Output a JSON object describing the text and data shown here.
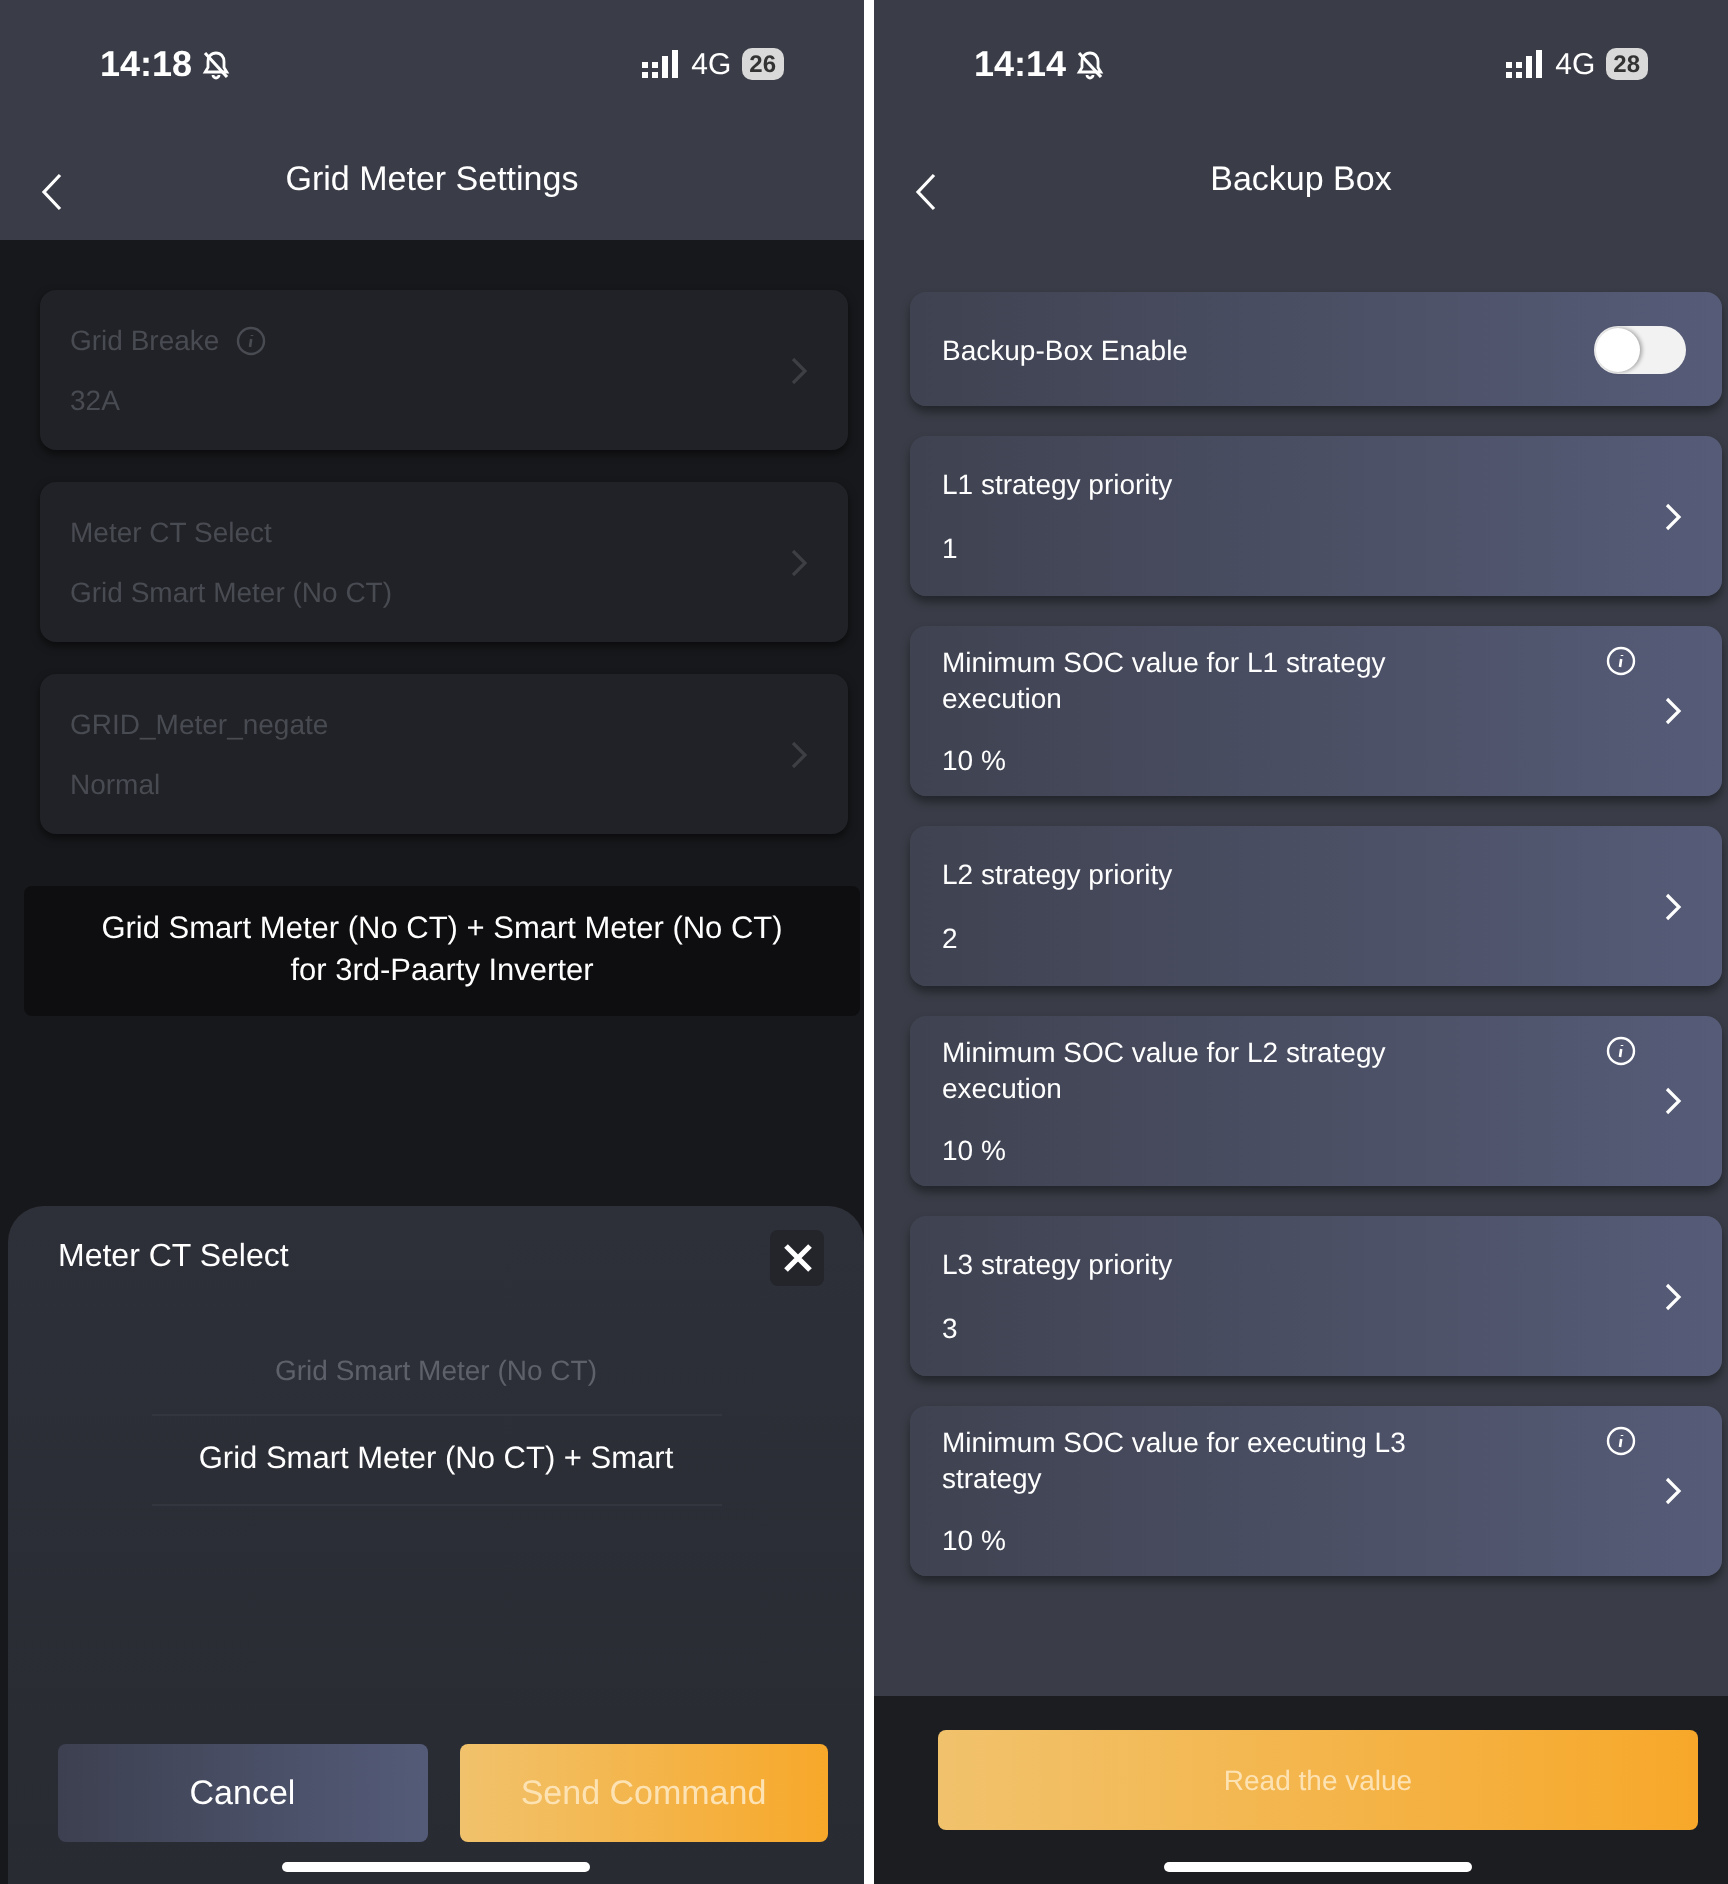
{
  "grid_meter_screen": {
    "status_bar": {
      "time": "14:18",
      "network": "4G",
      "battery": "26"
    },
    "nav_bar": {
      "title": "Grid Meter Settings"
    },
    "settings": [
      {
        "label": "Grid Breake",
        "value": "32A",
        "info": true
      },
      {
        "label": "Meter CT Select",
        "value": "Grid Smart Meter (No CT)",
        "info": false
      },
      {
        "label": "GRID_Meter_negate",
        "value": "Normal",
        "info": false
      }
    ],
    "toast": "Grid Smart Meter (No CT) + Smart Meter (No CT) for 3rd-Paarty Inverter",
    "sheet": {
      "title": "Meter CT Select",
      "options": [
        {
          "label": "Grid Smart Meter (No CT)",
          "selected": false
        },
        {
          "label": "Grid Smart Meter (No CT) + Smart",
          "selected": true
        }
      ],
      "buttons": [
        {
          "label": "Cancel",
          "kind": "secondary"
        },
        {
          "label": "Send Command",
          "kind": "primary"
        }
      ]
    }
  },
  "backup_box_screen": {
    "status_bar": {
      "time": "14:14",
      "network": "4G",
      "battery": "28"
    },
    "nav_bar": {
      "title": "Backup Box"
    },
    "settings": [
      {
        "kind": "toggle",
        "label": "Backup-Box Enable",
        "on": false
      },
      {
        "kind": "select",
        "label": "L1 strategy priority",
        "value": "1",
        "info": false
      },
      {
        "kind": "select",
        "label": "Minimum SOC value for L1 strategy execution",
        "value": "10 %",
        "info": true
      },
      {
        "kind": "select",
        "label": "L2 strategy priority",
        "value": "2",
        "info": false
      },
      {
        "kind": "select",
        "label": "Minimum SOC value for L2 strategy execution",
        "value": "10 %",
        "info": true
      },
      {
        "kind": "select",
        "label": "L3 strategy priority",
        "value": "3",
        "info": false
      },
      {
        "kind": "select",
        "label": "Minimum SOC value for executing L3 strategy",
        "value": "10 %",
        "info": true
      }
    ],
    "button": "Read the value"
  }
}
